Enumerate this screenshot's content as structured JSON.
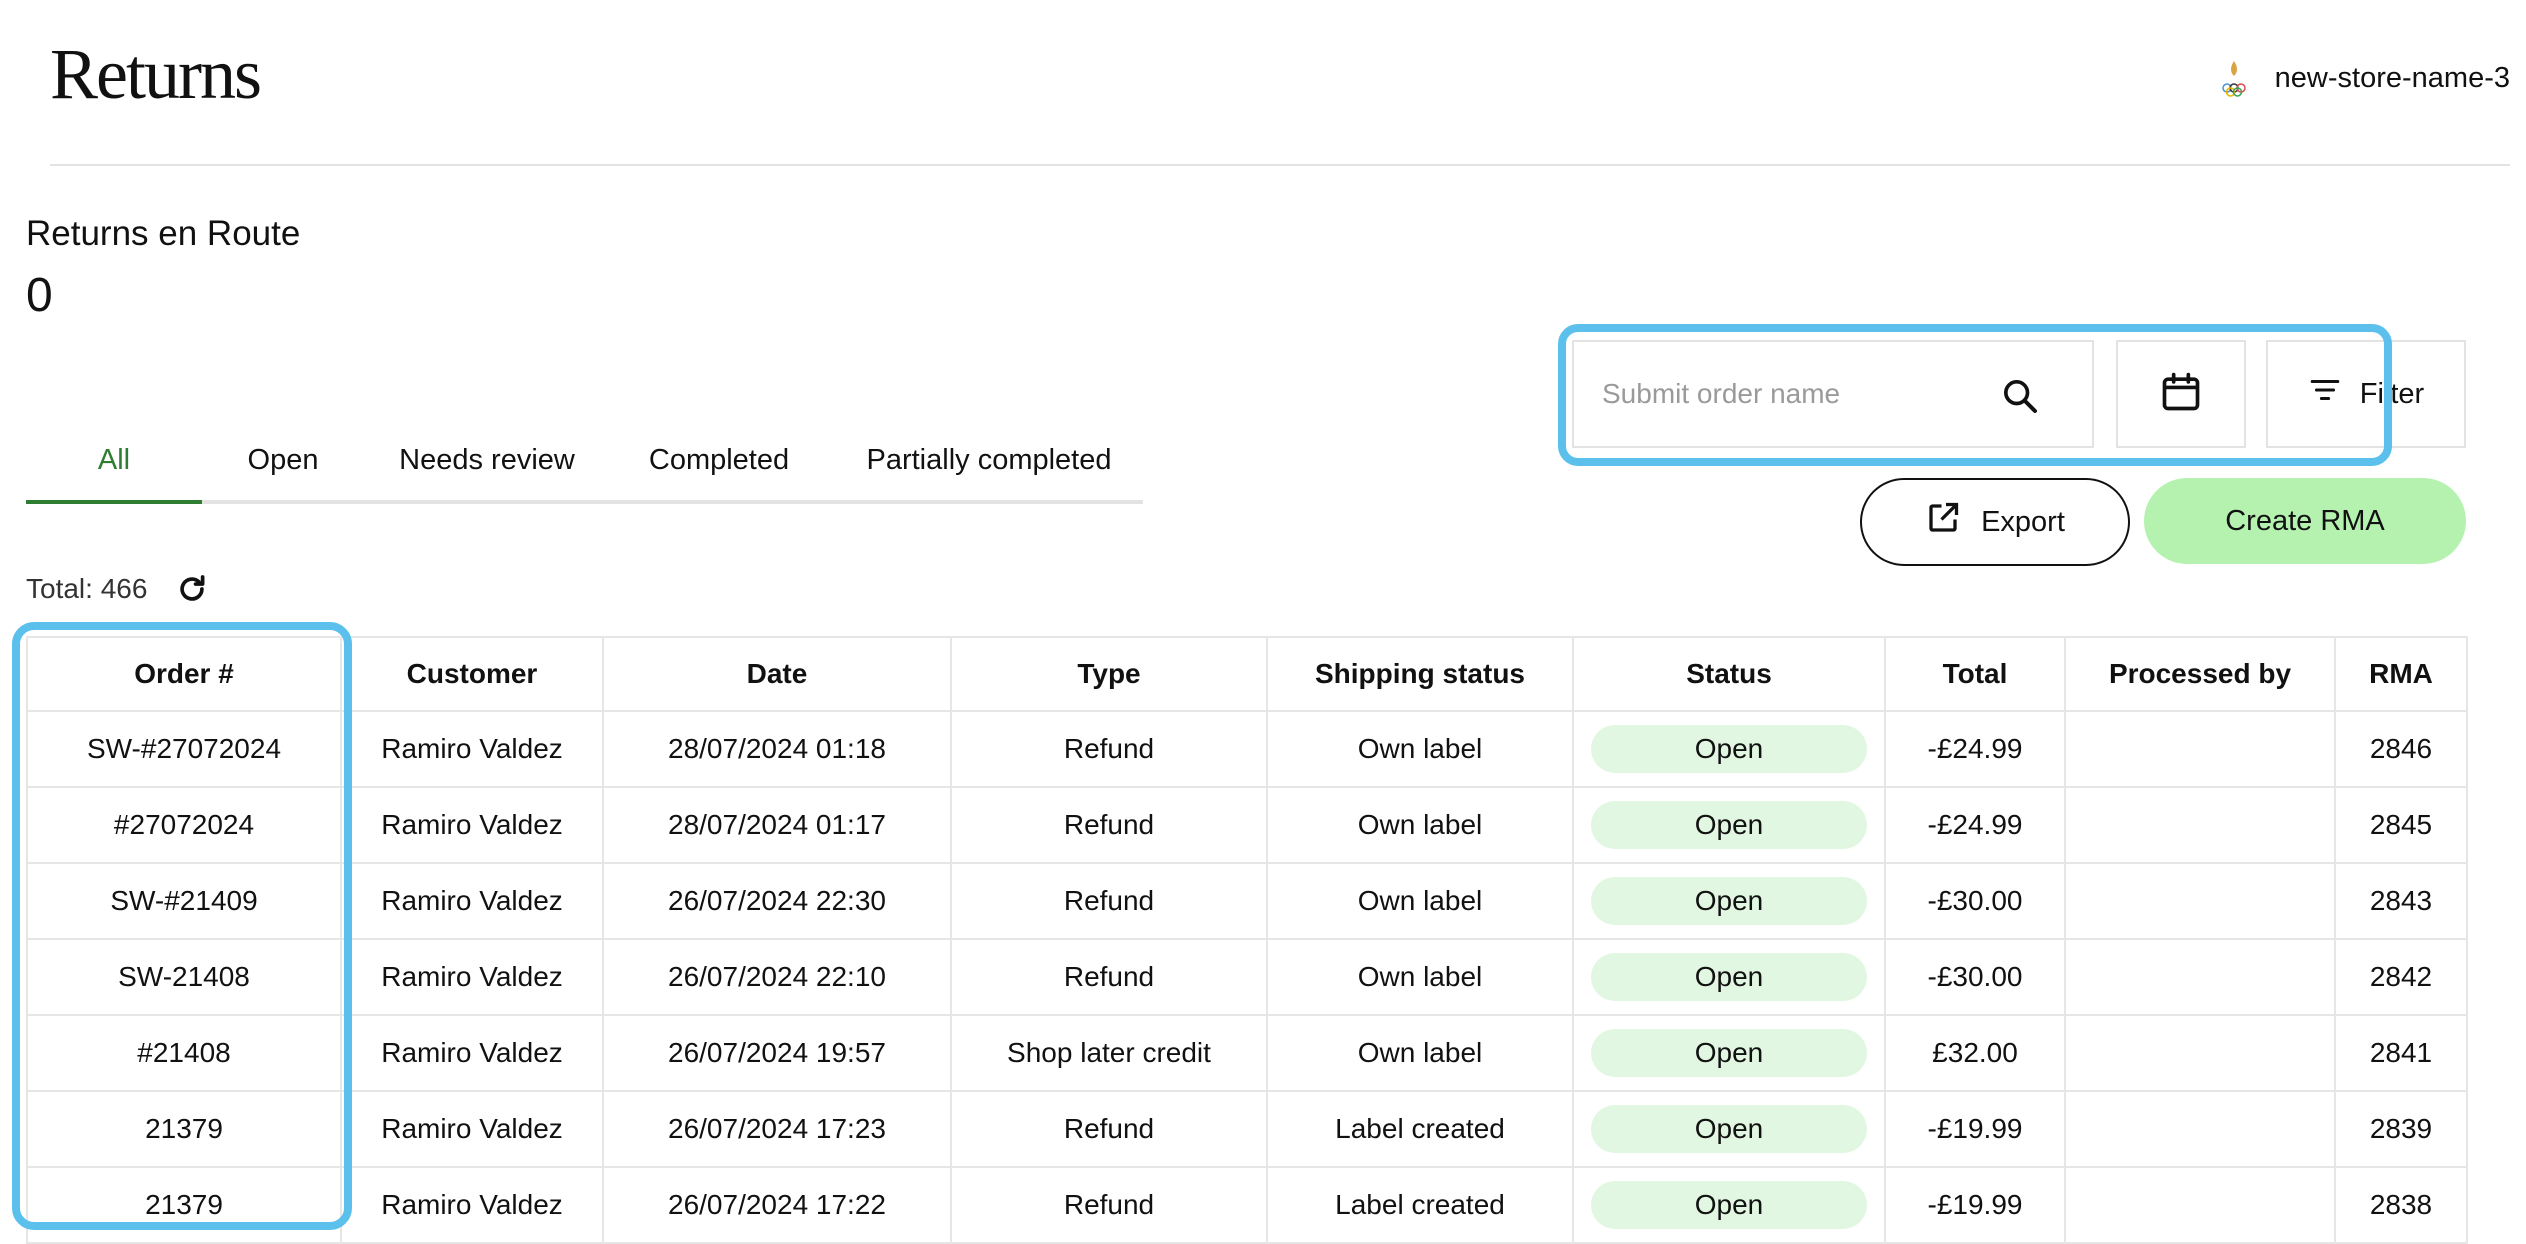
{
  "header": {
    "title": "Returns",
    "store_name": "new-store-name-3"
  },
  "metric": {
    "label": "Returns en Route",
    "value": "0"
  },
  "tabs": [
    {
      "label": "All",
      "active": true
    },
    {
      "label": "Open",
      "active": false
    },
    {
      "label": "Needs review",
      "active": false
    },
    {
      "label": "Completed",
      "active": false
    },
    {
      "label": "Partially completed",
      "active": false
    }
  ],
  "toolbar": {
    "search_placeholder": "Submit order name",
    "filter_label": "Filter",
    "export_label": "Export",
    "create_label": "Create RMA"
  },
  "total_label": "Total: 466",
  "table": {
    "columns": [
      "Order #",
      "Customer",
      "Date",
      "Type",
      "Shipping status",
      "Status",
      "Total",
      "Processed by",
      "RMA"
    ],
    "rows": [
      [
        "SW-#27072024",
        "Ramiro Valdez",
        "28/07/2024 01:18",
        "Refund",
        "Own label",
        "Open",
        "-£24.99",
        "",
        "2846"
      ],
      [
        "#27072024",
        "Ramiro Valdez",
        "28/07/2024 01:17",
        "Refund",
        "Own label",
        "Open",
        "-£24.99",
        "",
        "2845"
      ],
      [
        "SW-#21409",
        "Ramiro Valdez",
        "26/07/2024 22:30",
        "Refund",
        "Own label",
        "Open",
        "-£30.00",
        "",
        "2843"
      ],
      [
        "SW-21408",
        "Ramiro Valdez",
        "26/07/2024 22:10",
        "Refund",
        "Own label",
        "Open",
        "-£30.00",
        "",
        "2842"
      ],
      [
        "#21408",
        "Ramiro Valdez",
        "26/07/2024 19:57",
        "Shop later credit",
        "Own label",
        "Open",
        "£32.00",
        "",
        "2841"
      ],
      [
        "21379",
        "Ramiro Valdez",
        "26/07/2024 17:23",
        "Refund",
        "Label created",
        "Open",
        "-£19.99",
        "",
        "2839"
      ],
      [
        "21379",
        "Ramiro Valdez",
        "26/07/2024 17:22",
        "Refund",
        "Label created",
        "Open",
        "-£19.99",
        "",
        "2838"
      ]
    ]
  },
  "colors": {
    "accent_green": "#2e7d32",
    "create_button_bg": "#b5f2b0",
    "status_pill_bg": "#e2f7e2",
    "highlight_border": "#5bc0eb"
  },
  "icons": {
    "search": "search-icon",
    "calendar": "calendar-icon",
    "filter": "filter-icon",
    "export": "external-link-icon",
    "refresh": "refresh-icon",
    "store_logo": "store-logo-icon"
  }
}
